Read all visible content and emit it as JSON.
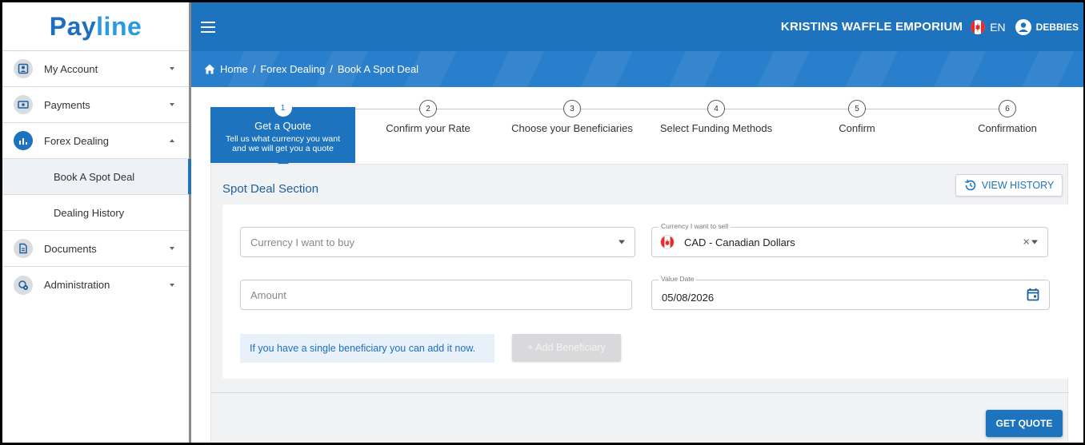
{
  "brand": {
    "logo_pay": "Pay",
    "logo_line": "line",
    "primary_color": "#1e73be"
  },
  "sidebar": {
    "items": [
      {
        "label": "My Account",
        "icon": "account-icon"
      },
      {
        "label": "Payments",
        "icon": "payments-icon"
      },
      {
        "label": "Forex Dealing",
        "icon": "chart-icon",
        "expanded": true,
        "children": [
          {
            "label": "Book A Spot Deal",
            "active": true
          },
          {
            "label": "Dealing History"
          }
        ]
      },
      {
        "label": "Documents",
        "icon": "document-icon"
      },
      {
        "label": "Administration",
        "icon": "admin-icon"
      }
    ]
  },
  "topbar": {
    "company": "KRISTINS WAFFLE EMPORIUM",
    "language": "EN",
    "user": "DEBBIES"
  },
  "breadcrumb": {
    "home": "Home",
    "sep": "/",
    "level1": "Forex Dealing",
    "level2": "Book A Spot Deal"
  },
  "stepper": {
    "steps": [
      {
        "num": "1",
        "label": "Get a Quote",
        "desc1": "Tell us what currency you want",
        "desc2": "and we will get you a quote",
        "active": true
      },
      {
        "num": "2",
        "label": "Confirm your Rate"
      },
      {
        "num": "3",
        "label": "Choose your Beneficiaries"
      },
      {
        "num": "4",
        "label": "Select Funding Methods"
      },
      {
        "num": "5",
        "label": "Confirm"
      },
      {
        "num": "6",
        "label": "Confirmation"
      }
    ]
  },
  "section": {
    "title": "Spot Deal Section",
    "view_history": "VIEW HISTORY"
  },
  "form": {
    "buy_placeholder": "Currency I want to buy",
    "sell_legend": "Currency I want to sell",
    "sell_value": "CAD - Canadian Dollars",
    "amount_placeholder": "Amount",
    "value_date_legend": "Value Date",
    "value_date": "05/08/2026",
    "beneficiary_info": "If you have a single beneficiary you can add it now.",
    "add_beneficiary": "+ Add Beneficiary",
    "get_quote": "GET QUOTE"
  }
}
